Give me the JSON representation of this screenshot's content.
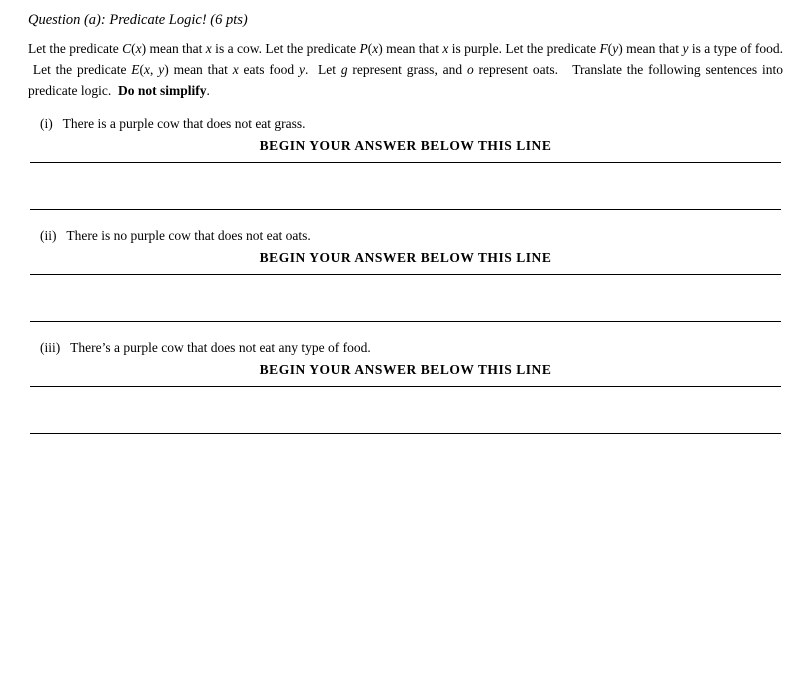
{
  "title": "Question (a): Predicate Logic! (6 pts)",
  "intro": {
    "text": "Let the predicate C(x) mean that x is a cow. Let the predicate P(x) mean that x is purple. Let the predicate F(y) mean that y is a type of food. Let the predicate E(x, y) mean that x eats food y. Let g represent grass, and o represent oats. Translate the following sentences into predicate logic. Do not simplify."
  },
  "subquestions": [
    {
      "label": "(i)  There is a purple cow that does not eat grass.",
      "answer_header": "BEGIN YOUR ANSWER BELOW THIS LINE"
    },
    {
      "label": "(ii)  There is no purple cow that does not eat oats.",
      "answer_header": "BEGIN YOUR ANSWER BELOW THIS LINE"
    },
    {
      "label": "(iii)  There’s a purple cow that does not eat any type of food.",
      "answer_header": "BEGIN YOUR ANSWER BELOW THIS LINE"
    }
  ]
}
